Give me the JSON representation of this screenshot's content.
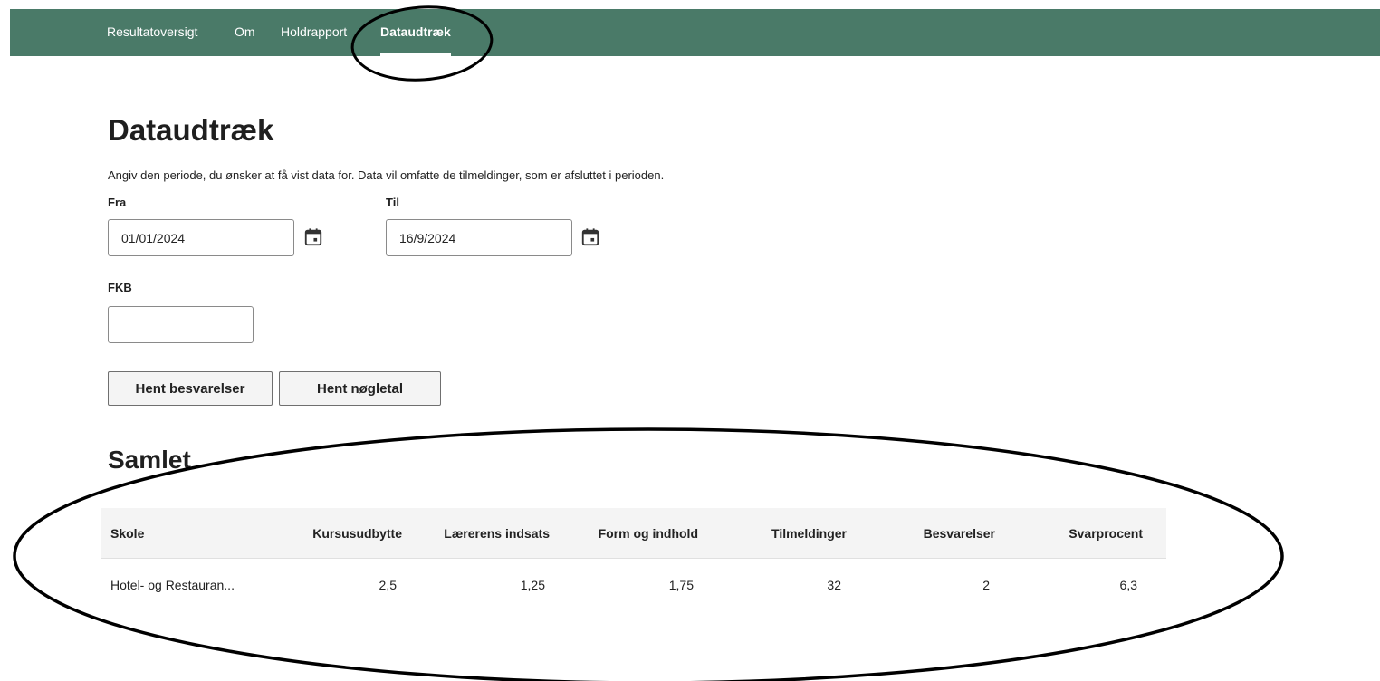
{
  "nav": {
    "items": [
      {
        "label": "Resultatoversigt"
      },
      {
        "label": "Om"
      },
      {
        "label": "Holdrapport"
      },
      {
        "label": "Dataudtræk",
        "active": true
      }
    ]
  },
  "page": {
    "title": "Dataudtræk",
    "intro": "Angiv den periode, du ønsker at få vist data for. Data vil omfatte de tilmeldinger, som er afsluttet i perioden."
  },
  "form": {
    "from_label": "Fra",
    "from_value": "01/01/2024",
    "to_label": "Til",
    "to_value": "16/9/2024",
    "fkb_label": "FKB",
    "fkb_value": "",
    "calendar_icon": "calendar-icon"
  },
  "buttons": {
    "hent_besvarelser": "Hent besvarelser",
    "hent_noegletal": "Hent nøgletal"
  },
  "summary": {
    "title": "Samlet",
    "columns": [
      "Skole",
      "Kursusudbytte",
      "Lærerens indsats",
      "Form og indhold",
      "Tilmeldinger",
      "Besvarelser",
      "Svarprocent"
    ],
    "rows": [
      [
        "Hotel- og Restauran...",
        "2,5",
        "1,25",
        "1,75",
        "32",
        "2",
        "6,3"
      ]
    ]
  },
  "colors": {
    "nav_bg": "#4a7a68",
    "header_row_bg": "#f4f4f4"
  }
}
